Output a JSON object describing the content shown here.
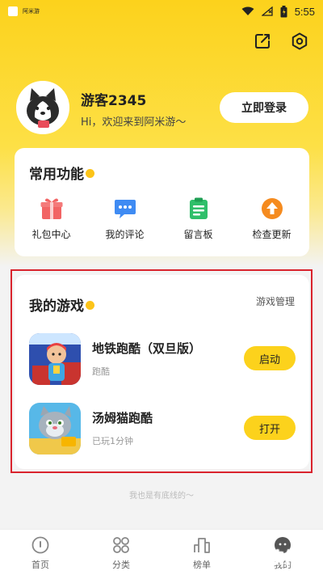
{
  "status_bar": {
    "app_name": "阿米游",
    "time": "5:55"
  },
  "profile": {
    "username": "游客2345",
    "welcome": "Hi，欢迎来到阿米游～",
    "login_label": "立即登录"
  },
  "functions": {
    "title": "常用功能",
    "items": [
      {
        "label": "礼包中心",
        "icon": "gift-icon",
        "color": "#f26464"
      },
      {
        "label": "我的评论",
        "icon": "comment-icon",
        "color": "#3f8bf3"
      },
      {
        "label": "留言板",
        "icon": "message-board-icon",
        "color": "#2fbf6a"
      },
      {
        "label": "检查更新",
        "icon": "update-icon",
        "color": "#f58b1f"
      }
    ]
  },
  "games": {
    "title": "我的游戏",
    "manage_label": "游戏管理",
    "items": [
      {
        "title": "地铁跑酷（双旦版）",
        "sub": "跑酷",
        "button": "启动",
        "icon": "subway-surfers-icon"
      },
      {
        "title": "汤姆猫跑酷",
        "sub": "已玩1分钟",
        "button": "打开",
        "icon": "tom-runner-icon"
      }
    ]
  },
  "footer_note": "我也是有底线的～",
  "tabs": [
    {
      "label": "首页",
      "icon": "home-icon"
    },
    {
      "label": "分类",
      "icon": "category-icon"
    },
    {
      "label": "榜单",
      "icon": "ranking-icon"
    },
    {
      "label": "我的",
      "icon": "profile-icon"
    }
  ],
  "watermark": "谷普软件园",
  "colors": {
    "accent": "#fcd21c",
    "highlight_border": "#d9232d"
  }
}
